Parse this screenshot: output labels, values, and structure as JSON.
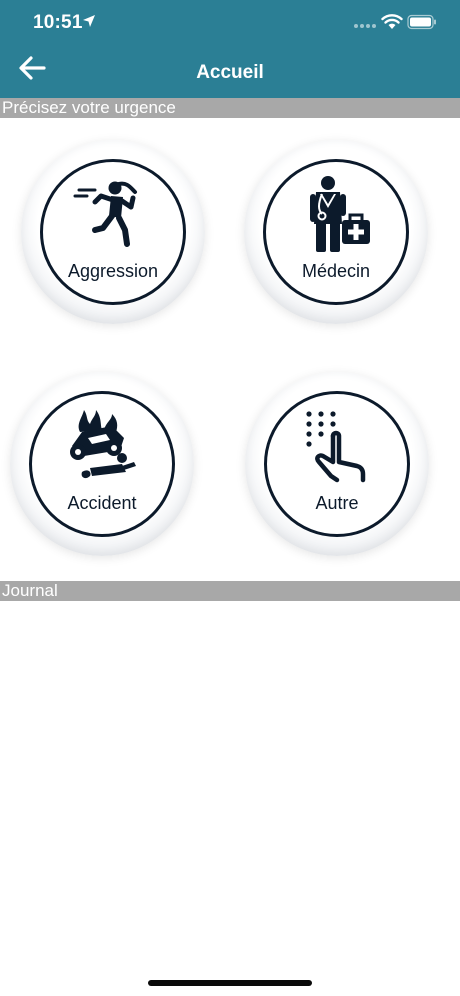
{
  "status_bar": {
    "time": "10:51"
  },
  "nav": {
    "title": "Accueil"
  },
  "sections": {
    "urgence_header": "Précisez votre urgence",
    "journal_header": "Journal"
  },
  "urgences": [
    {
      "label": "Aggression",
      "icon": "aggression-icon"
    },
    {
      "label": "Médecin",
      "icon": "doctor-icon"
    },
    {
      "label": "Accident",
      "icon": "accident-icon"
    },
    {
      "label": "Autre",
      "icon": "gesture-icon"
    }
  ],
  "colors": {
    "header_bg": "#2b7f95",
    "section_header_bg": "#a8a8a8",
    "icon_dark": "#0c1a2b"
  }
}
